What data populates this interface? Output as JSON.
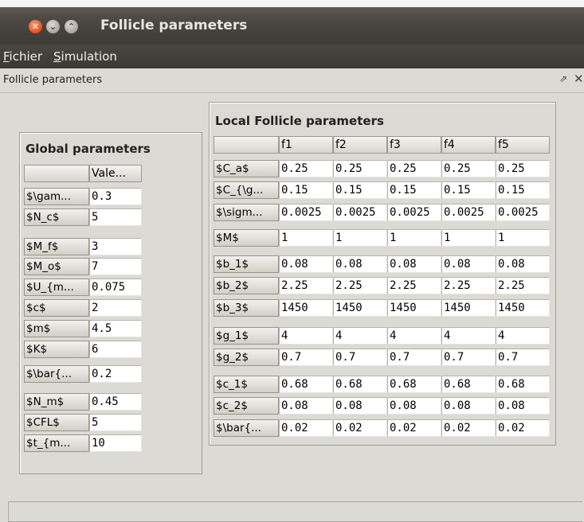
{
  "window": {
    "title": "Follicle parameters"
  },
  "menubar": {
    "items": [
      {
        "accel": "F",
        "rest": "ichier"
      },
      {
        "accel": "S",
        "rest": "imulation"
      }
    ]
  },
  "frame": {
    "title": "Follicle parameters",
    "pin_glyph": "⇗",
    "close_glyph": "✕"
  },
  "global": {
    "title": "Global parameters",
    "header": "Vale...",
    "rows": [
      [
        "$\\gam...",
        "0.3"
      ],
      [
        "$N_c$",
        "5"
      ],
      [
        "$M_f$",
        "3"
      ],
      [
        "$M_o$",
        "7"
      ],
      [
        "$U_{m...",
        "0.075"
      ],
      [
        "$c$",
        "2"
      ],
      [
        "$m$",
        "4.5"
      ],
      [
        "$K$",
        "6"
      ],
      [
        "$\\bar{...",
        "0.2"
      ],
      [
        "$N_m$",
        "0.45"
      ],
      [
        "$CFL$",
        "5"
      ],
      [
        "$t_{m...",
        "10"
      ]
    ]
  },
  "local": {
    "title": "Local Follicle parameters",
    "headers": [
      "f1",
      "f2",
      "f3",
      "f4",
      "f5"
    ],
    "rows": [
      [
        "$C_a$",
        "0.25",
        "0.25",
        "0.25",
        "0.25",
        "0.25"
      ],
      [
        "$C_{\\g...",
        "0.15",
        "0.15",
        "0.15",
        "0.15",
        "0.15"
      ],
      [
        "$\\sigm...",
        "0.0025",
        "0.0025",
        "0.0025",
        "0.0025",
        "0.0025"
      ],
      [
        "$M$",
        "1",
        "1",
        "1",
        "1",
        "1"
      ],
      [
        "$b_1$",
        "0.08",
        "0.08",
        "0.08",
        "0.08",
        "0.08"
      ],
      [
        "$b_2$",
        "2.25",
        "2.25",
        "2.25",
        "2.25",
        "2.25"
      ],
      [
        "$b_3$",
        "1450",
        "1450",
        "1450",
        "1450",
        "1450"
      ],
      [
        "$g_1$",
        "4",
        "4",
        "4",
        "4",
        "4"
      ],
      [
        "$g_2$",
        "0.7",
        "0.7",
        "0.7",
        "0.7",
        "0.7"
      ],
      [
        "$c_1$",
        "0.68",
        "0.68",
        "0.68",
        "0.68",
        "0.68"
      ],
      [
        "$c_2$",
        "0.08",
        "0.08",
        "0.08",
        "0.08",
        "0.08"
      ],
      [
        "$\\bar{...",
        "0.02",
        "0.02",
        "0.02",
        "0.02",
        "0.02"
      ]
    ]
  },
  "colors": {
    "titlebar": "#4d4a44",
    "close_button": "#e2501e",
    "background": "#dcdad5"
  }
}
